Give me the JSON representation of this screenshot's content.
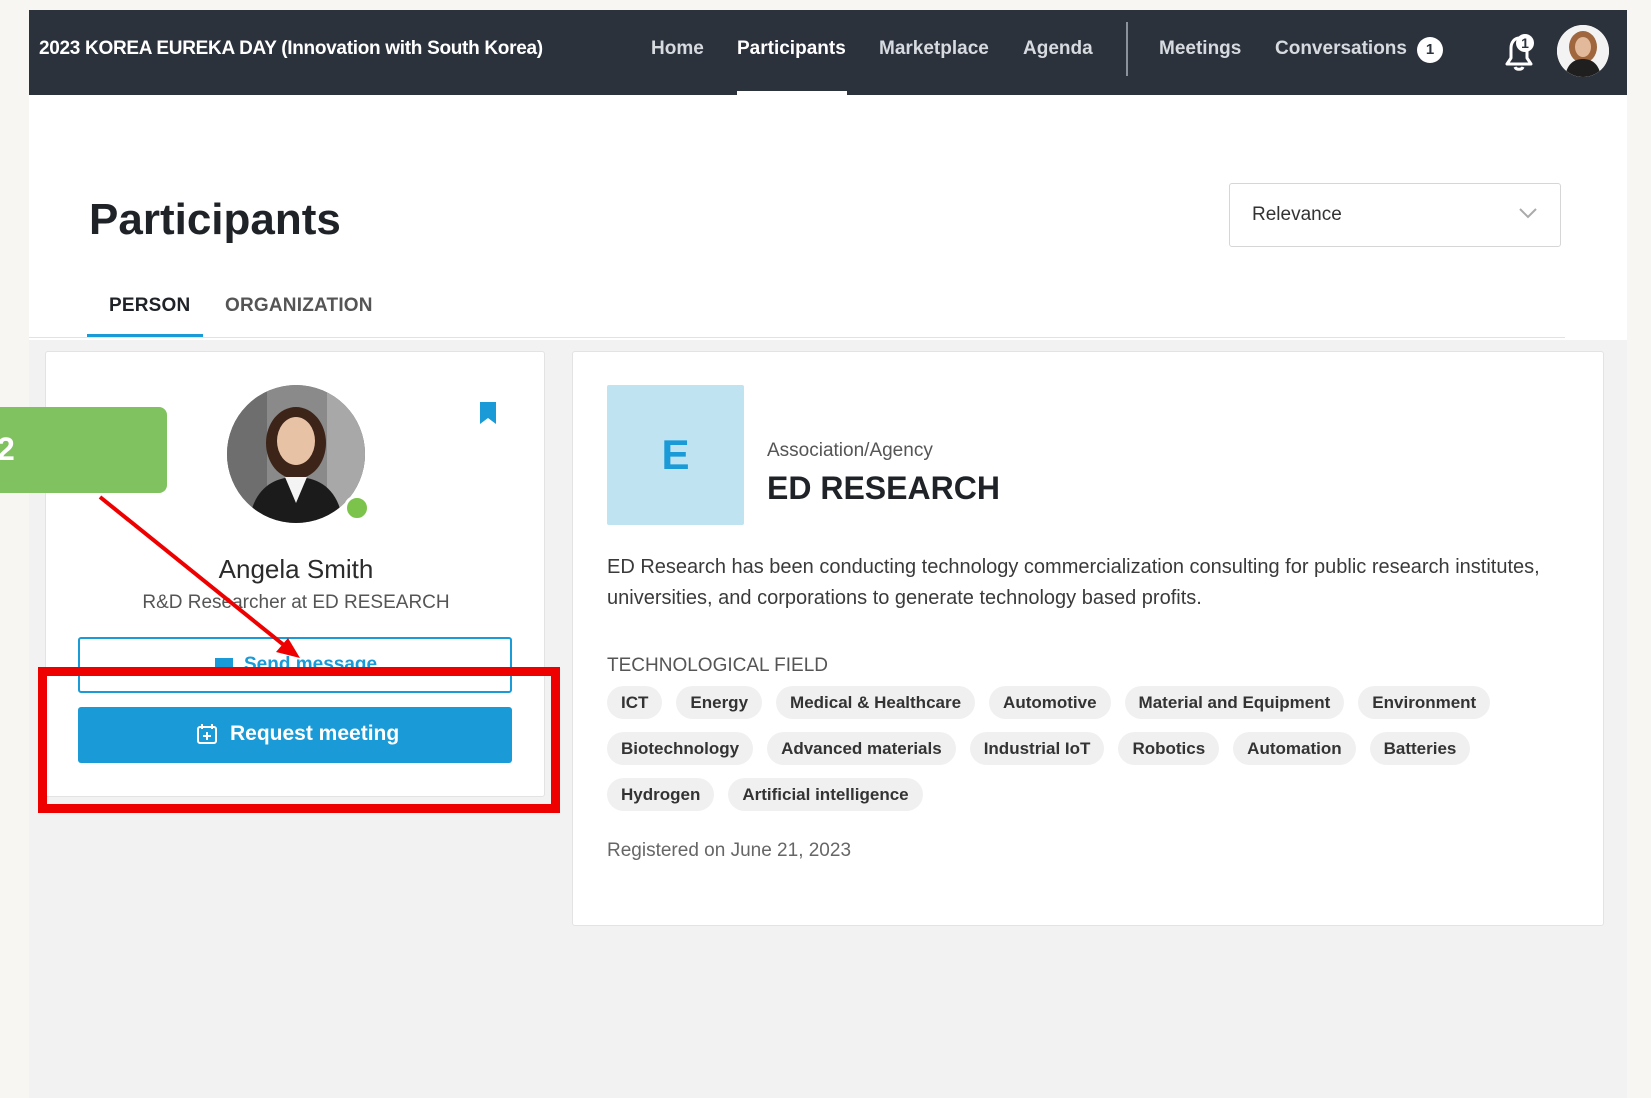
{
  "navbar": {
    "event_title": "2023 KOREA EUREKA DAY (Innovation with South Korea)",
    "links": [
      "Home",
      "Participants",
      "Marketplace",
      "Agenda",
      "Meetings",
      "Conversations"
    ],
    "conversations_count": "1",
    "notifications_count": "1"
  },
  "page": {
    "title": "Participants",
    "sort_value": "Relevance",
    "tabs": [
      "PERSON",
      "ORGANIZATION"
    ],
    "active_tab": "PERSON"
  },
  "person": {
    "name": "Angela Smith",
    "role": "R&D Researcher at ED RESEARCH",
    "status": "online",
    "send_message_label": "Send message",
    "request_meeting_label": "Request meeting"
  },
  "organization": {
    "logo_letter": "E",
    "type": "Association/Agency",
    "name": "ED RESEARCH",
    "description": "ED Research has been conducting technology commercialization consulting for public research institutes, universities, and corporations to generate technology based profits.",
    "tech_field_label": "TECHNOLOGICAL FIELD",
    "tags": [
      "ICT",
      "Energy",
      "Medical & Healthcare",
      "Automotive",
      "Material and Equipment",
      "Environment",
      "Biotechnology",
      "Advanced materials",
      "Industrial IoT",
      "Robotics",
      "Automation",
      "Batteries",
      "Hydrogen",
      "Artificial intelligence"
    ],
    "registered": "Registered on June 21, 2023"
  },
  "annotation": {
    "step_number": "2"
  },
  "colors": {
    "navbar_bg": "#2b323c",
    "accent": "#1a9ad6",
    "online": "#7cc34b",
    "annotation_red": "#ee0000",
    "annotation_green": "#7fc25f"
  }
}
